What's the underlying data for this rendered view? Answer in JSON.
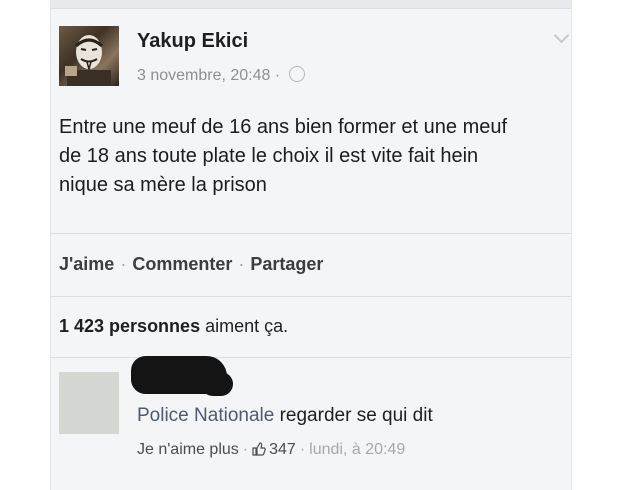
{
  "post": {
    "author": "Yakup Ekici",
    "date": "3 novembre, 20:48",
    "text_lines": [
      "Entre une meuf de 16 ans bien former et une meuf",
      "de 18 ans toute plate le choix il est vite fait hein",
      "nique sa mère la prison"
    ]
  },
  "actions": {
    "like": "J'aime",
    "comment": "Commenter",
    "share": "Partager"
  },
  "likes": {
    "count": "1 423 personnes",
    "suffix": "aiment ça."
  },
  "comment": {
    "commenter": "Police Nationale",
    "text": "regarder se qui dit",
    "unlike_label": "Je n'aime plus",
    "like_count": "347",
    "time": "lundi, à 20:49"
  },
  "icons": {
    "globe": "globe-icon",
    "chevron": "chevron-down-icon",
    "thumb": "thumbs-up-icon"
  }
}
